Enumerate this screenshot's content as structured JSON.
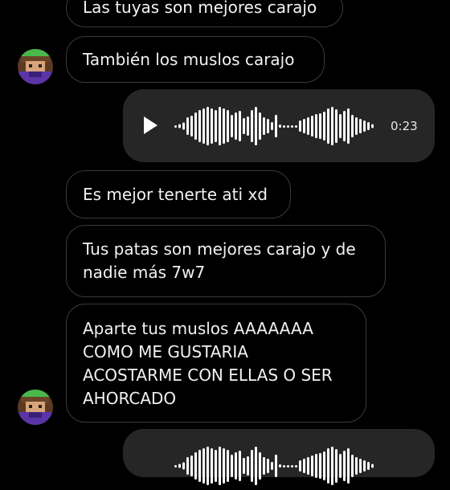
{
  "messages": [
    {
      "sender": "other",
      "text": "Las tuyas son mejores carajo"
    },
    {
      "sender": "other",
      "text": "También los muslos carajo"
    },
    {
      "sender": "me",
      "type": "voice",
      "duration": "0:23"
    },
    {
      "sender": "other",
      "text": "Es mejor tenerte ati xd"
    },
    {
      "sender": "other",
      "text": "Tus patas son mejores carajo y de\nnadie más 7w7"
    },
    {
      "sender": "other",
      "text": "Aparte tus muslos AAAAAAA\nCOMO ME GUSTARIA\nACOSTARME CON ELLAS O SER\nAHORCADO"
    },
    {
      "sender": "me",
      "type": "voice"
    }
  ],
  "icons": {
    "play": "play-icon",
    "avatar": "avatar"
  },
  "colors": {
    "background": "#000000",
    "bubble_border": "#3a3a3a",
    "voice_bubble": "#262626",
    "text": "#f2f2f2"
  }
}
